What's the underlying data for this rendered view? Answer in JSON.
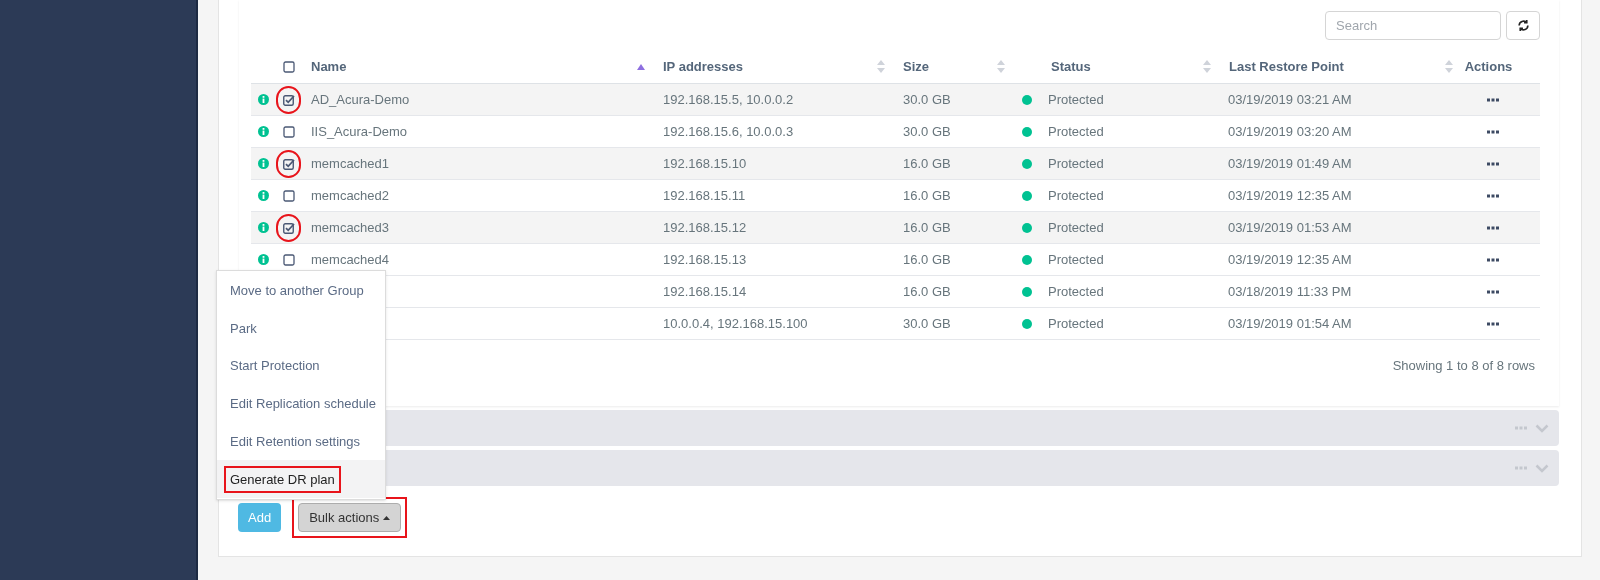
{
  "search": {
    "placeholder": "Search"
  },
  "table": {
    "columns": [
      {
        "kind": "info"
      },
      {
        "kind": "select",
        "checked": false
      },
      {
        "kind": "text",
        "label": "Name",
        "sorted": true
      },
      {
        "kind": "text",
        "label": "IP addresses",
        "sorted": false
      },
      {
        "kind": "text",
        "label": "Size",
        "sorted": false
      },
      {
        "kind": "dot"
      },
      {
        "kind": "text",
        "label": "Status",
        "sorted": false
      },
      {
        "kind": "text",
        "label": "Last Restore Point",
        "sorted": false
      },
      {
        "kind": "text",
        "label": "Actions"
      }
    ],
    "rows": [
      {
        "name": "AD_Acura-Demo",
        "checked": true,
        "annotated": true,
        "ip": "192.168.15.5, 10.0.0.2",
        "size": "30.0 GB",
        "color": "#00c292",
        "status": "Protected",
        "restore": "03/19/2019 03:21 AM"
      },
      {
        "name": "IIS_Acura-Demo",
        "checked": false,
        "annotated": false,
        "ip": "192.168.15.6, 10.0.0.3",
        "size": "30.0 GB",
        "color": "#00c292",
        "status": "Protected",
        "restore": "03/19/2019 03:20 AM"
      },
      {
        "name": "memcached1",
        "checked": true,
        "annotated": true,
        "ip": "192.168.15.10",
        "size": "16.0 GB",
        "color": "#00c292",
        "status": "Protected",
        "restore": "03/19/2019 01:49 AM"
      },
      {
        "name": "memcached2",
        "checked": false,
        "annotated": false,
        "ip": "192.168.15.11",
        "size": "16.0 GB",
        "color": "#00c292",
        "status": "Protected",
        "restore": "03/19/2019 12:35 AM"
      },
      {
        "name": "memcached3",
        "checked": true,
        "annotated": true,
        "ip": "192.168.15.12",
        "size": "16.0 GB",
        "color": "#00c292",
        "status": "Protected",
        "restore": "03/19/2019 01:53 AM"
      },
      {
        "name": "memcached4",
        "checked": false,
        "annotated": false,
        "ip": "192.168.15.13",
        "size": "16.0 GB",
        "color": "#00c292",
        "status": "Protected",
        "restore": "03/19/2019 12:35 AM"
      },
      {
        "ip": "192.168.15.14",
        "size": "16.0 GB",
        "color": "#00c292",
        "status": "Protected",
        "restore": "03/18/2019 11:33 PM"
      },
      {
        "ip": "10.0.0.4, 192.168.15.100",
        "size": "30.0 GB",
        "color": "#00c292",
        "status": "Protected",
        "restore": "03/19/2019 01:54 AM"
      }
    ],
    "footer": "Showing 1 to 8 of 8 rows"
  },
  "panels": [
    {
      "expanded": false
    },
    {
      "expanded": false
    }
  ],
  "bulk_menu": [
    {
      "label": "Move to another Group",
      "highlighted": false,
      "annotated": false
    },
    {
      "label": "Park",
      "highlighted": false,
      "annotated": false
    },
    {
      "label": "Start Protection",
      "highlighted": false,
      "annotated": false
    },
    {
      "label": "Edit Replication schedule",
      "highlighted": false,
      "annotated": false
    },
    {
      "label": "Edit Retention settings",
      "highlighted": false,
      "annotated": false
    },
    {
      "label": "Generate DR plan",
      "highlighted": true,
      "annotated": true
    }
  ],
  "buttons": [
    {
      "kind": "primary",
      "label": "Add",
      "annotated": false
    },
    {
      "kind": "dropdown",
      "label": "Bulk actions",
      "annotated": true,
      "expanded": true
    }
  ]
}
